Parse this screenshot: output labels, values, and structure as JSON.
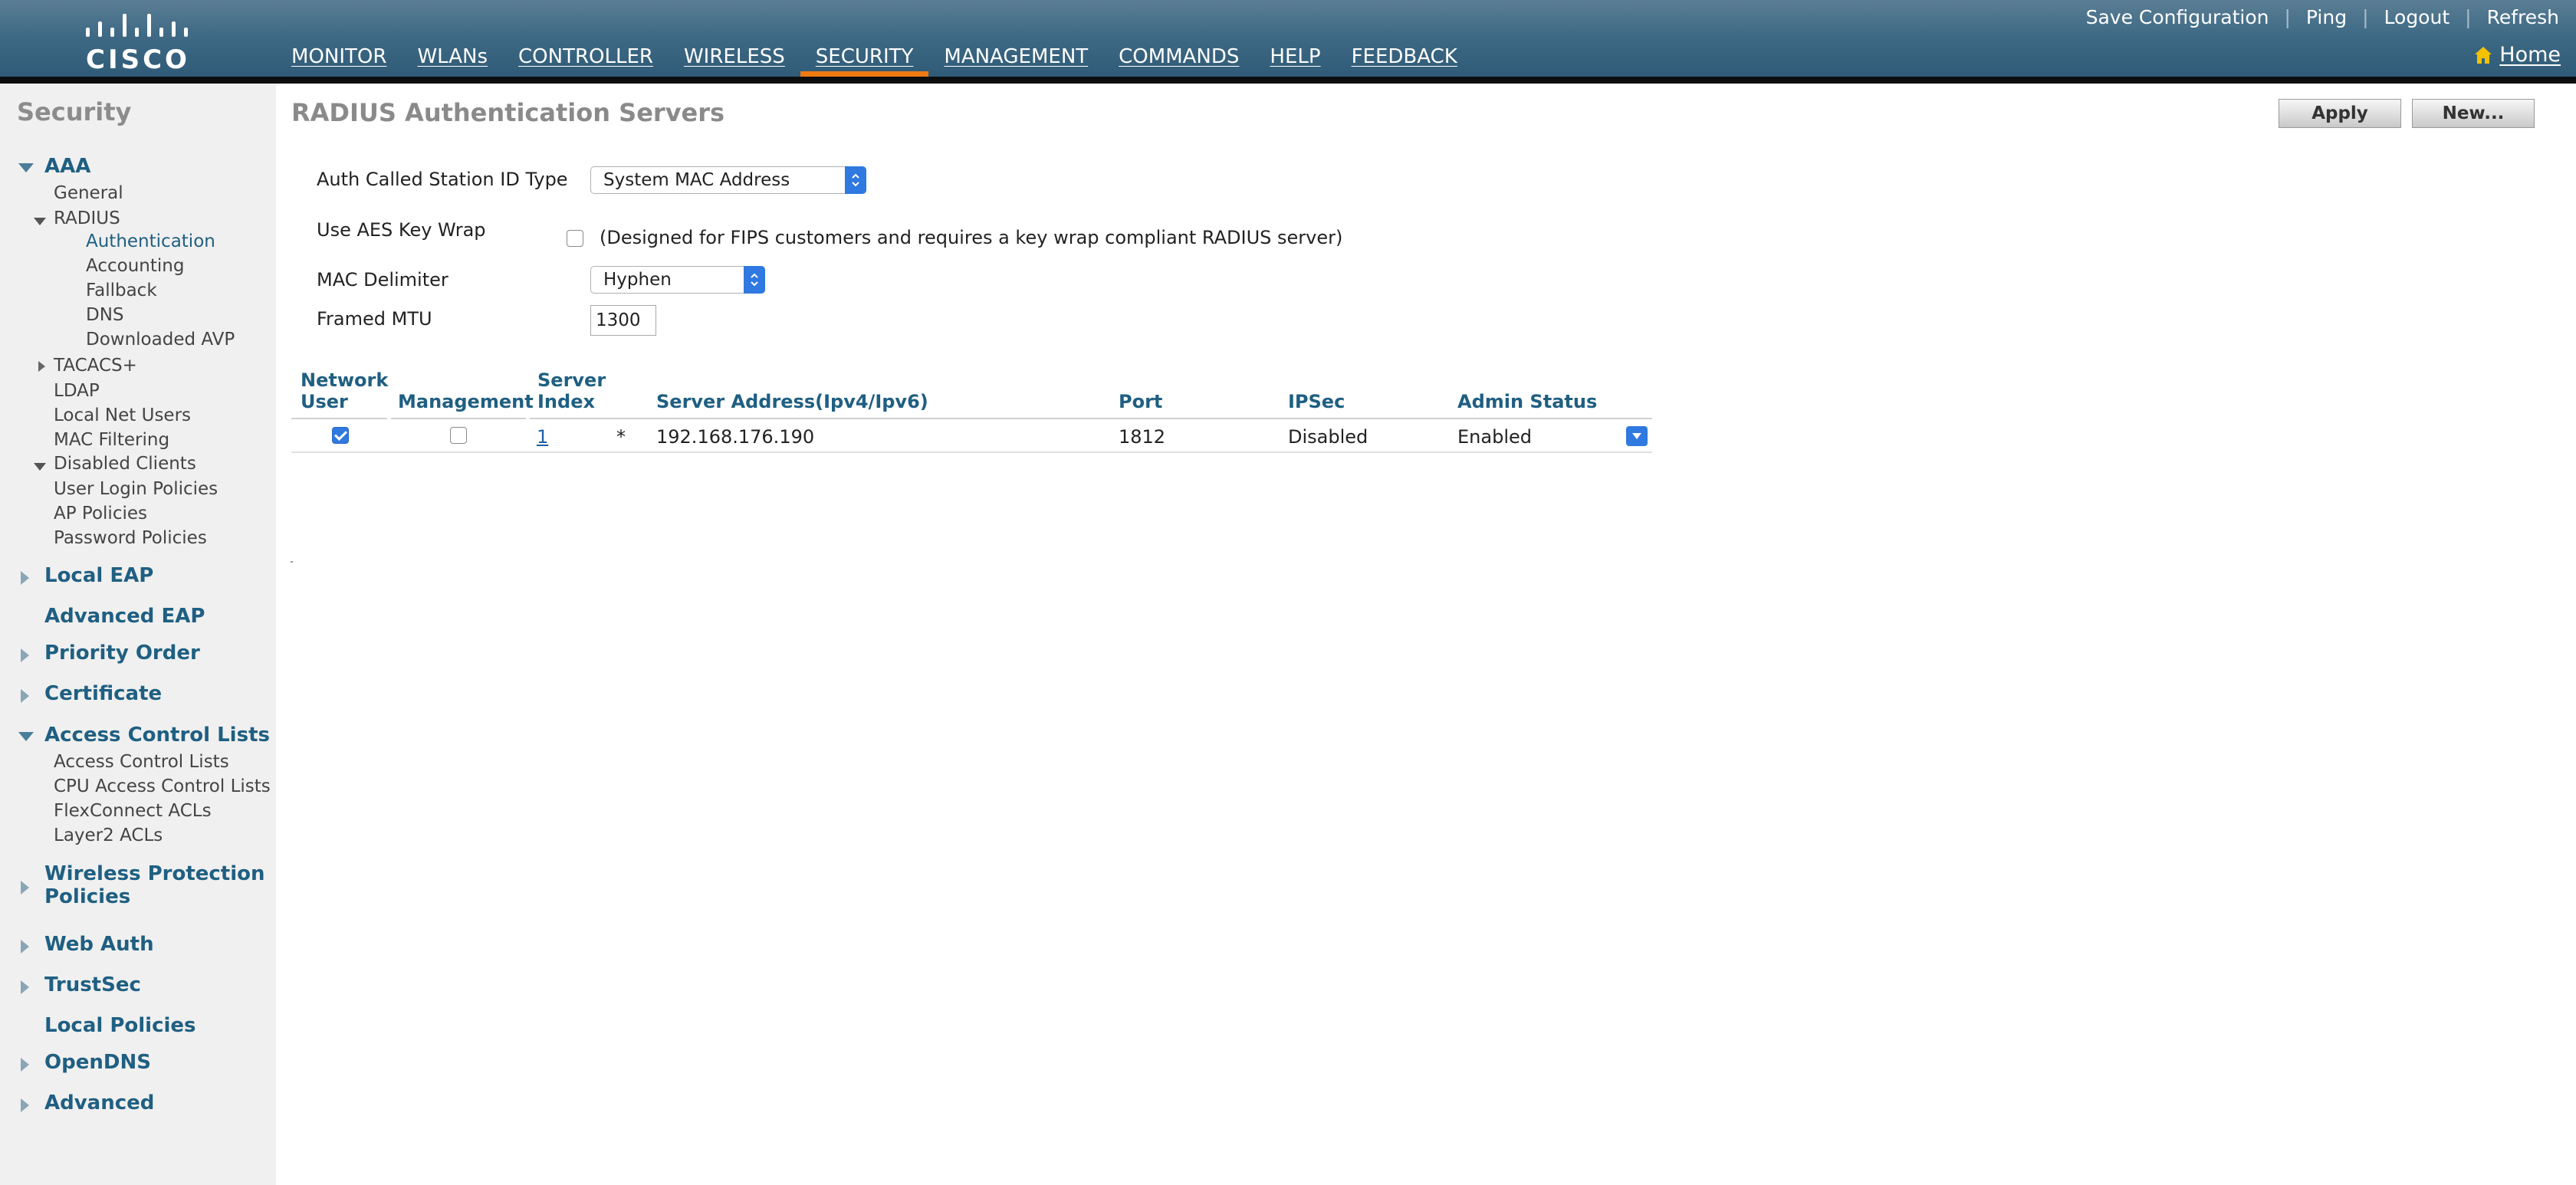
{
  "header": {
    "logo_text": "CISCO",
    "nav": [
      "MONITOR",
      "WLANs",
      "CONTROLLER",
      "WIRELESS",
      "SECURITY",
      "MANAGEMENT",
      "COMMANDS",
      "HELP",
      "FEEDBACK"
    ],
    "active_nav": "SECURITY",
    "util_links": [
      "Save Configuration",
      "Ping",
      "Logout",
      "Refresh"
    ],
    "util_separator": "|",
    "home_label": "Home",
    "colors": {
      "bar": "#3f6a85",
      "active_underline": "#f07a12",
      "home_icon": "#f2c200"
    }
  },
  "sidebar": {
    "title": "Security",
    "aaa": {
      "label": "AAA",
      "general": "General",
      "radius": "RADIUS",
      "radius_items": [
        "Authentication",
        "Accounting",
        "Fallback",
        "DNS",
        "Downloaded AVP"
      ],
      "tacacs": "TACACS+",
      "ldap": "LDAP",
      "local_net_users": "Local Net Users",
      "mac_filtering": "MAC Filtering",
      "disabled_clients": "Disabled Clients",
      "user_login_policies": "User Login Policies",
      "ap_policies": "AP Policies",
      "password_policies": "Password Policies"
    },
    "local_eap": "Local EAP",
    "advanced_eap": "Advanced EAP",
    "priority_order": "Priority Order",
    "certificate": "Certificate",
    "acl": {
      "label": "Access Control Lists",
      "items": [
        "Access Control Lists",
        "CPU Access Control Lists",
        "FlexConnect ACLs",
        "Layer2 ACLs"
      ]
    },
    "wireless_protection_1": "Wireless Protection",
    "wireless_protection_2": "Policies",
    "web_auth": "Web Auth",
    "trustsec": "TrustSec",
    "local_policies": "Local Policies",
    "opendns": "OpenDNS",
    "advanced": "Advanced",
    "selected_item": "Authentication"
  },
  "main": {
    "title": "RADIUS Authentication Servers",
    "apply_label": "Apply",
    "new_label": "New...",
    "form": {
      "auth_called_label": "Auth Called Station ID Type",
      "auth_called_value": "System MAC Address",
      "aes_label": "Use AES Key Wrap",
      "aes_checked": false,
      "aes_note": "(Designed for FIPS customers and requires a key wrap compliant RADIUS server)",
      "mac_delim_label": "MAC Delimiter",
      "mac_delim_value": "Hyphen",
      "mtu_label": "Framed MTU",
      "mtu_value": "1300"
    },
    "table": {
      "headers": {
        "network_user_1": "Network",
        "network_user_2": "User",
        "management": "Management",
        "server_index_1": "Server",
        "server_index_2": "Index",
        "server_address": "Server Address(Ipv4/Ipv6)",
        "port": "Port",
        "ipsec": "IPSec",
        "admin_status": "Admin Status"
      },
      "rows": [
        {
          "network_user": true,
          "management": false,
          "index": "1",
          "marker": "*",
          "address": "192.168.176.190",
          "port": "1812",
          "ipsec": "Disabled",
          "admin_status": "Enabled"
        }
      ]
    }
  }
}
